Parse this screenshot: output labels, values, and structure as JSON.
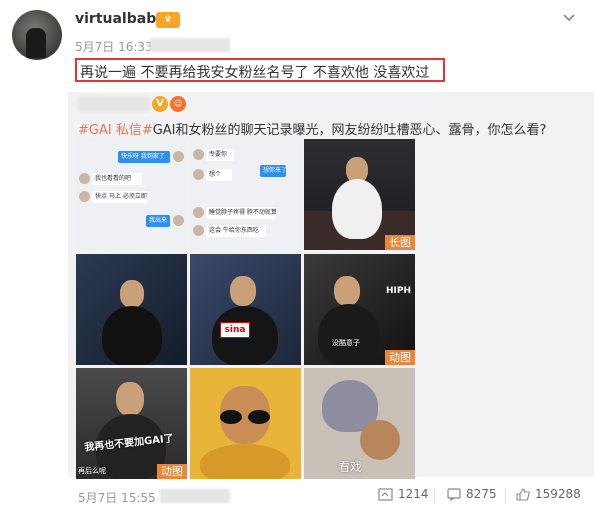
{
  "post": {
    "username": "virtualbabe",
    "time": "5月7日 16:33",
    "text": "再说一遍 不要再给我安女粉丝名号了 不喜欢他 没喜欢过"
  },
  "repost": {
    "tag1": "#GAI 私信#",
    "body": "GAI和女粉丝的聊天记录曝光，网友纷纷吐槽恶心、露骨，你怎么看?",
    "badges": {
      "long": "长图",
      "gif1": "动图",
      "gif2": "动图"
    },
    "chat1": [
      "快乐呀 我到家了",
      "我也看看的吧",
      "快点 马上 必须立即",
      "我出来"
    ],
    "chat2": [
      "专要你",
      "想个",
      "想你来了",
      "睡觉脖子疼得 脖不动就算了",
      "这会 牛给你东西吃"
    ],
    "meme_caption": "我再也不要加GAI了",
    "meme_small": "再后么呢",
    "watch_caption": "看戏",
    "sina_logo": "sina",
    "hiphop_text": "HIPH",
    "tap_text": "没酷意子"
  },
  "footer": {
    "time": "5月7日 15:55",
    "reposts": "1214",
    "comments": "8275",
    "likes": "159288"
  },
  "colors": {
    "highlight_border": "#e63333",
    "tag": "#eb7350",
    "badge": "#e8873c",
    "vip": "#f5a623"
  },
  "icons": [
    "chevron-down-icon",
    "repost-icon",
    "comment-icon",
    "like-icon",
    "vip-icon"
  ]
}
